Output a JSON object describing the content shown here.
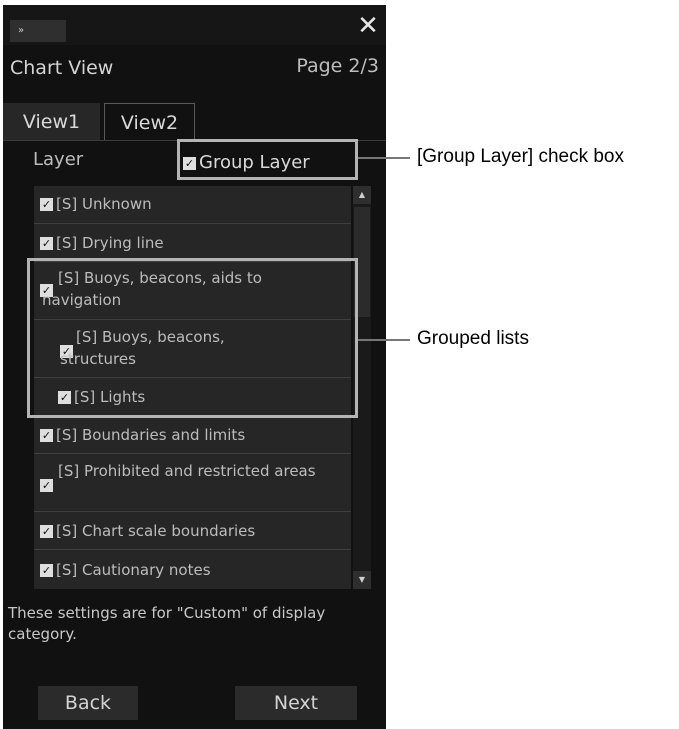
{
  "toolbar": {
    "collapse_icon": "»",
    "close_icon": "✕"
  },
  "header": {
    "title": "Chart View",
    "page": "Page 2/3"
  },
  "tabs": [
    {
      "label": "View1",
      "selected": true
    },
    {
      "label": "View2",
      "selected": false
    }
  ],
  "layer_label": "Layer",
  "group_layer": {
    "label": "Group Layer",
    "checked": true
  },
  "checkbox_glyph": "✓",
  "layers": [
    {
      "label": "[S] Unknown",
      "checked": true
    },
    {
      "label": "[S] Drying line",
      "checked": true
    },
    {
      "label": "[S] Buoys, beacons, aids to navigation",
      "checked": true
    },
    {
      "label": "[S] Buoys, beacons, structures",
      "checked": true
    },
    {
      "label": "[S] Lights",
      "checked": true
    },
    {
      "label": "[S] Boundaries and limits",
      "checked": true
    },
    {
      "label": "[S] Prohibited and restricted areas",
      "checked": true
    },
    {
      "label": "[S] Chart scale boundaries",
      "checked": true
    },
    {
      "label": "[S] Cautionary notes",
      "checked": true
    }
  ],
  "note": "These settings are for \"Custom\" of display category.",
  "buttons": {
    "back": "Back",
    "next": "Next"
  },
  "callouts": {
    "group_layer_checkbox": "[Group Layer] check box",
    "grouped_lists": "Grouped lists"
  },
  "colors": {
    "panel_bg": "#111111",
    "list_bg": "#262626",
    "highlight": "#b4b4b4"
  }
}
